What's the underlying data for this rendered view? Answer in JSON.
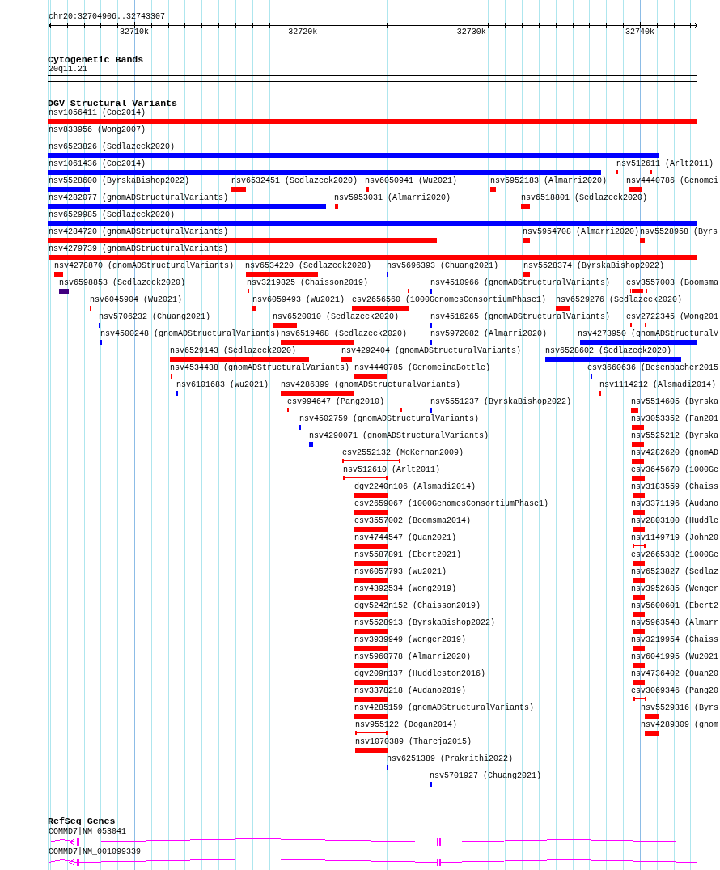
{
  "ruler": {
    "position": "chr20:32704906..32743307",
    "ticks": [
      "32710k",
      "32720k",
      "32730k",
      "32740k"
    ]
  },
  "cytogenetic_bands": {
    "title": "Cytogenetic Bands",
    "band": "20q11.21"
  },
  "dgv_structural_variants": {
    "title": "DGV Structural Variants",
    "rows": [
      {
        "features": [
          {
            "label": "nsv1056411 (Coe2014)",
            "kind": "block",
            "color": "#ff0000"
          }
        ]
      },
      {
        "features": [
          {
            "label": "nsv833956 (Wong2007)",
            "kind": "line",
            "color": "#ff0000"
          }
        ]
      },
      {
        "features": [
          {
            "label": "nsv6523826 (Sedlazeck2020)",
            "kind": "block",
            "color": "#0000ff"
          }
        ]
      },
      {
        "features": [
          {
            "label": "nsv1061436 (Coe2014)",
            "kind": "block",
            "color": "#0000ff"
          },
          {
            "label": "nsv512611 (Arlt2011)",
            "kind": "range",
            "color": "#ff0000"
          }
        ]
      },
      {
        "features": [
          {
            "label": "nsv5528600 (ByrskaBishop2022)",
            "kind": "block",
            "color": "#0000ff"
          },
          {
            "label": "nsv6532451 (Sedlazeck2020)",
            "kind": "block",
            "color": "#ff0000"
          },
          {
            "label": "nsv6050941 (Wu2021)",
            "kind": "block",
            "color": "#ff0000"
          },
          {
            "label": "nsv5952183 (Almarri2020)",
            "kind": "block",
            "color": "#ff0000"
          },
          {
            "label": "nsv4440786 (Genomei",
            "kind": "block",
            "color": "#ff0000"
          }
        ]
      },
      {
        "features": [
          {
            "label": "nsv4282077 (gnomADStructuralVariants)",
            "kind": "block",
            "color": "#0000ff"
          },
          {
            "label": "nsv5953031 (Almarri2020)",
            "kind": "block",
            "color": "#ff0000"
          },
          {
            "label": "nsv6518801 (Sedlazeck2020)",
            "kind": "block",
            "color": "#ff0000"
          }
        ]
      },
      {
        "features": [
          {
            "label": "nsv6529985 (Sedlazeck2020)",
            "kind": "block",
            "color": "#0000ff"
          }
        ]
      },
      {
        "features": [
          {
            "label": "nsv4284720 (gnomADStructuralVariants)",
            "kind": "block",
            "color": "#ff0000"
          },
          {
            "label": "nsv5954708 (Almarri2020)",
            "kind": "block",
            "color": "#ff0000"
          },
          {
            "label": "nsv5528958 (Byrs",
            "kind": "block",
            "color": "#ff0000"
          }
        ]
      },
      {
        "features": [
          {
            "label": "nsv4279739 (gnomADStructuralVariants)",
            "kind": "block",
            "color": "#ff0000"
          }
        ]
      },
      {
        "features": [
          {
            "label": "nsv4278870 (gnomADStructuralVariants)",
            "kind": "block",
            "color": "#ff0000"
          },
          {
            "label": "nsv6534220 (Sedlazeck2020)",
            "kind": "block",
            "color": "#ff0000"
          },
          {
            "label": "nsv5696393 (Chuang2021)",
            "kind": "block",
            "color": "#0000ff"
          },
          {
            "label": "nsv5528374 (ByrskaBishop2022)",
            "kind": "block",
            "color": "#ff0000"
          }
        ]
      },
      {
        "features": [
          {
            "label": "nsv6598853 (Sedlazeck2020)",
            "kind": "block",
            "color": "#400080"
          },
          {
            "label": "nsv3219825 (Chaisson2019)",
            "kind": "range",
            "color": "#ff0000"
          },
          {
            "label": "nsv4510966 (gnomADStructuralVariants)",
            "kind": "block",
            "color": "#0000ff"
          },
          {
            "label": "esv3557003 (Boomsma",
            "kind": "block_range",
            "color": "#ff0000"
          }
        ]
      },
      {
        "features": [
          {
            "label": "nsv6045904 (Wu2021)",
            "kind": "block",
            "color": "#ff0000"
          },
          {
            "label": "nsv6059493 (Wu2021)",
            "kind": "block",
            "color": "#ff0000"
          },
          {
            "label": "esv2656560 (1000GenomesConsortiumPhase1)",
            "kind": "block",
            "color": "#ff0000"
          },
          {
            "label": "nsv6529276 (Sedlazeck2020)",
            "kind": "block",
            "color": "#ff0000"
          }
        ]
      },
      {
        "features": [
          {
            "label": "nsv5706232 (Chuang2021)",
            "kind": "block",
            "color": "#0000ff"
          },
          {
            "label": "nsv6520010 (Sedlazeck2020)",
            "kind": "block",
            "color": "#ff0000"
          },
          {
            "label": "nsv4516265 (gnomADStructuralVariants)",
            "kind": "block",
            "color": "#0000ff"
          },
          {
            "label": "esv2722345 (Wong201",
            "kind": "range",
            "color": "#ff0000"
          }
        ]
      },
      {
        "features": [
          {
            "label": "nsv4500248 (gnomADStructuralVariants)",
            "kind": "block",
            "color": "#0000ff"
          },
          {
            "label": "nsv6519468 (Sedlazeck2020)",
            "kind": "block",
            "color": "#ff0000"
          },
          {
            "label": "nsv5972082 (Almarri2020)",
            "kind": "block",
            "color": "#0000ff"
          },
          {
            "label": "nsv4273950 (gnomADStructuralV",
            "kind": "block",
            "color": "#0000ff"
          }
        ]
      },
      {
        "features": [
          {
            "label": "nsv6529143 (Sedlazeck2020)",
            "kind": "block",
            "color": "#ff0000"
          },
          {
            "label": "nsv4292404 (gnomADStructuralVariants)",
            "kind": "block",
            "color": "#ff0000"
          },
          {
            "label": "nsv6528602 (Sedlazeck2020)",
            "kind": "block",
            "color": "#0000ff"
          }
        ]
      },
      {
        "features": [
          {
            "label": "nsv4534438 (gnomADStructuralVariants)",
            "kind": "block",
            "color": "#ff0000"
          },
          {
            "label": "nsv4440785 (GenomeinaBottle)",
            "kind": "block",
            "color": "#ff0000"
          },
          {
            "label": "esv3660636 (Besenbacher2015",
            "kind": "block",
            "color": "#0000ff"
          }
        ]
      },
      {
        "features": [
          {
            "label": "nsv6101683 (Wu2021)",
            "kind": "block",
            "color": "#0000ff"
          },
          {
            "label": "nsv4286399 (gnomADStructuralVariants)",
            "kind": "block",
            "color": "#ff0000"
          },
          {
            "label": "nsv1114212 (Alsmadi2014)",
            "kind": "block",
            "color": "#ff0000"
          }
        ]
      },
      {
        "features": [
          {
            "label": "esv994647 (Pang2010)",
            "kind": "range",
            "color": "#ff0000"
          },
          {
            "label": "nsv5551237 (ByrskaBishop2022)",
            "kind": "block",
            "color": "#0000ff"
          },
          {
            "label": "nsv5514605 (Byrska",
            "kind": "block",
            "color": "#ff0000"
          }
        ]
      },
      {
        "features": [
          {
            "label": "nsv4502759 (gnomADStructuralVariants)",
            "kind": "block",
            "color": "#0000ff"
          },
          {
            "label": "nsv3053352 (Fan201",
            "kind": "block",
            "color": "#ff0000"
          }
        ]
      },
      {
        "features": [
          {
            "label": "nsv4290071 (gnomADStructuralVariants)",
            "kind": "block",
            "color": "#0000ff"
          },
          {
            "label": "nsv5525212 (Byrska",
            "kind": "block",
            "color": "#ff0000"
          }
        ]
      },
      {
        "features": [
          {
            "label": "esv2552132 (McKernan2009)",
            "kind": "range",
            "color": "#ff0000"
          },
          {
            "label": "nsv4282620 (gnomAD",
            "kind": "block",
            "color": "#ff0000"
          }
        ]
      },
      {
        "features": [
          {
            "label": "nsv512610 (Arlt2011)",
            "kind": "range",
            "color": "#ff0000"
          },
          {
            "label": "esv3645670 (1000Ge",
            "kind": "block",
            "color": "#ff0000"
          }
        ]
      },
      {
        "features": [
          {
            "label": "dgv2240n106 (Alsmadi2014)",
            "kind": "block",
            "color": "#ff0000"
          },
          {
            "label": "nsv3183559 (Chaiss",
            "kind": "block",
            "color": "#ff0000"
          }
        ]
      },
      {
        "features": [
          {
            "label": "esv2659067 (1000GenomesConsortiumPhase1)",
            "kind": "block",
            "color": "#ff0000"
          },
          {
            "label": "nsv3371196 (Audano",
            "kind": "block",
            "color": "#ff0000"
          }
        ]
      },
      {
        "features": [
          {
            "label": "esv3557002 (Boomsma2014)",
            "kind": "block",
            "color": "#ff0000"
          },
          {
            "label": "nsv2803100 (Huddle",
            "kind": "block",
            "color": "#ff0000"
          }
        ]
      },
      {
        "features": [
          {
            "label": "nsv4744547 (Quan2021)",
            "kind": "block",
            "color": "#ff0000"
          },
          {
            "label": "nsv1149719 (John20",
            "kind": "range",
            "color": "#ff0000"
          }
        ]
      },
      {
        "features": [
          {
            "label": "nsv5587891 (Ebert2021)",
            "kind": "block",
            "color": "#ff0000"
          },
          {
            "label": "esv2665382 (1000Ge",
            "kind": "block",
            "color": "#ff0000"
          }
        ]
      },
      {
        "features": [
          {
            "label": "nsv6057793 (Wu2021)",
            "kind": "block",
            "color": "#ff0000"
          },
          {
            "label": "nsv6523827 (Sedlaz",
            "kind": "block",
            "color": "#ff0000"
          }
        ]
      },
      {
        "features": [
          {
            "label": "nsv4392534 (Wong2019)",
            "kind": "block",
            "color": "#ff0000"
          },
          {
            "label": "nsv3952685 (Wenger",
            "kind": "block",
            "color": "#ff0000"
          }
        ]
      },
      {
        "features": [
          {
            "label": "dgv5242n152 (Chaisson2019)",
            "kind": "block",
            "color": "#ff0000"
          },
          {
            "label": "nsv5600601 (Ebert2",
            "kind": "block",
            "color": "#ff0000"
          }
        ]
      },
      {
        "features": [
          {
            "label": "nsv5528913 (ByrskaBishop2022)",
            "kind": "block",
            "color": "#ff0000"
          },
          {
            "label": "nsv5963548 (Almarr",
            "kind": "block",
            "color": "#ff0000"
          }
        ]
      },
      {
        "features": [
          {
            "label": "nsv3939949 (Wenger2019)",
            "kind": "block",
            "color": "#ff0000"
          },
          {
            "label": "nsv3219954 (Chaiss",
            "kind": "block",
            "color": "#ff0000"
          }
        ]
      },
      {
        "features": [
          {
            "label": "nsv5960778 (Almarri2020)",
            "kind": "block",
            "color": "#ff0000"
          },
          {
            "label": "nsv6041995 (Wu2021",
            "kind": "block",
            "color": "#ff0000"
          }
        ]
      },
      {
        "features": [
          {
            "label": "dgv209n137 (Huddleston2016)",
            "kind": "block",
            "color": "#ff0000"
          },
          {
            "label": "nsv4736402 (Quan20",
            "kind": "block",
            "color": "#ff0000"
          }
        ]
      },
      {
        "features": [
          {
            "label": "nsv3378218 (Audano2019)",
            "kind": "block",
            "color": "#ff0000"
          },
          {
            "label": "esv3069346 (Pang20",
            "kind": "range",
            "color": "#ff0000"
          }
        ]
      },
      {
        "features": [
          {
            "label": "nsv4285159 (gnomADStructuralVariants)",
            "kind": "block",
            "color": "#ff0000"
          },
          {
            "label": "nsv5529316 (Byrs",
            "kind": "block",
            "color": "#ff0000"
          }
        ]
      },
      {
        "features": [
          {
            "label": "nsv955122 (Dogan2014)",
            "kind": "range",
            "color": "#ff0000"
          },
          {
            "label": "nsv4289309 (gnom",
            "kind": "block",
            "color": "#ff0000"
          }
        ]
      },
      {
        "features": [
          {
            "label": "nsv1070389 (Thareja2015)",
            "kind": "block",
            "color": "#ff0000"
          }
        ]
      },
      {
        "features": [
          {
            "label": "nsv6251389 (Prakrithi2022)",
            "kind": "block",
            "color": "#0000ff"
          }
        ]
      },
      {
        "features": [
          {
            "label": "nsv5701927 (Chuang2021)",
            "kind": "block",
            "color": "#0000ff"
          }
        ]
      }
    ]
  },
  "refseq_genes": {
    "title": "RefSeq Genes",
    "transcripts": [
      {
        "label": "COMMD7|NM_053041"
      },
      {
        "label": "COMMD7|NM_001099339"
      }
    ]
  }
}
